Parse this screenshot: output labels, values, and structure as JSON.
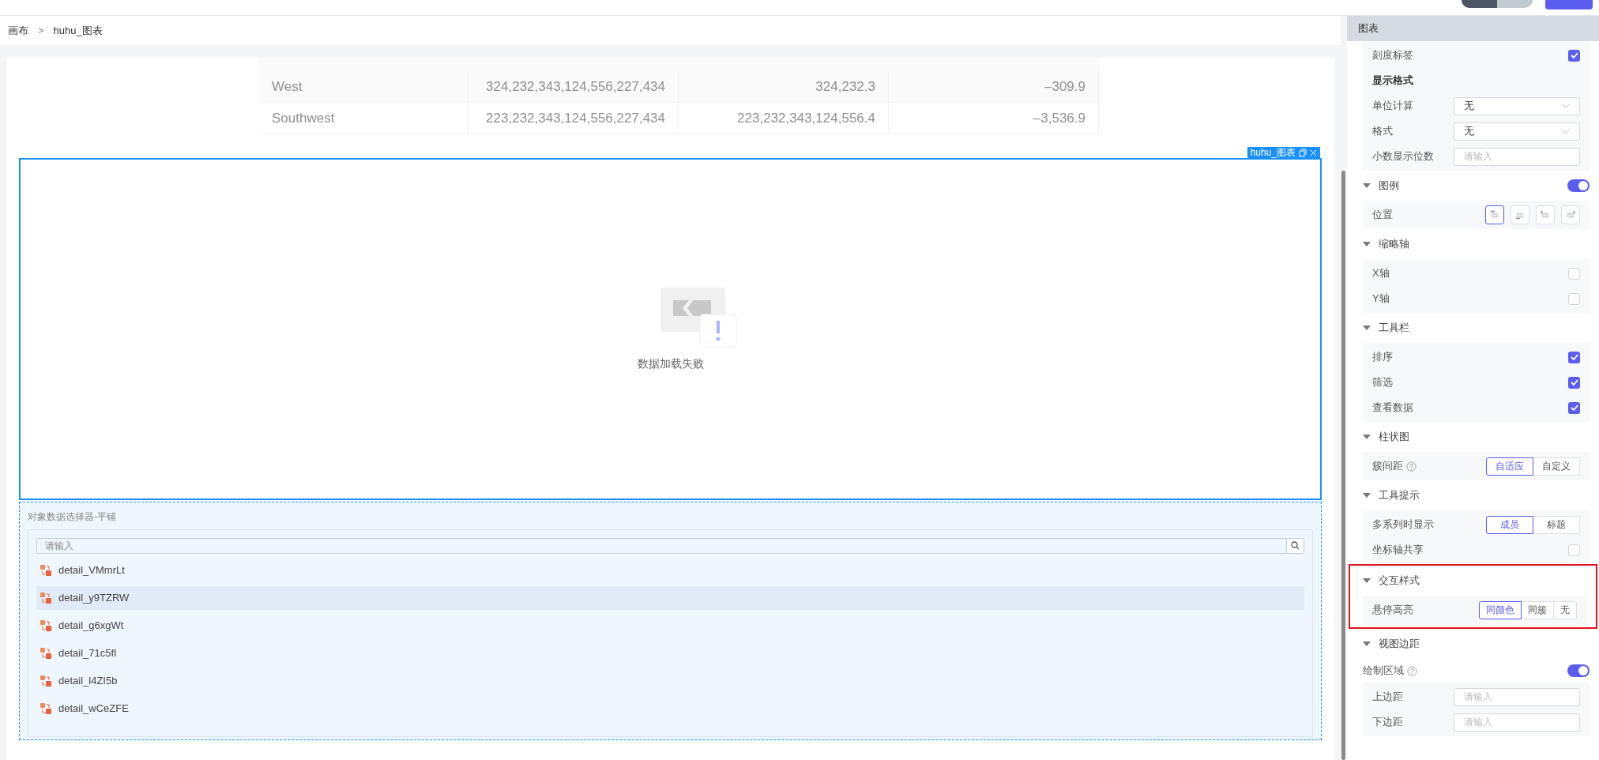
{
  "breadcrumb": {
    "items": [
      "画布",
      "huhu_图表"
    ],
    "separator": ">"
  },
  "table": {
    "rows": [
      {
        "cells": [
          "West",
          "324,232,343,124,556,227,434",
          "324,232.3",
          "–309.9"
        ]
      },
      {
        "cells": [
          "Southwest",
          "223,232,343,124,556,227,434",
          "223,232,343,124,556.4",
          "–3,536.9"
        ]
      }
    ]
  },
  "chart_widget": {
    "tag": "huhu_图表",
    "message": "数据加载失败"
  },
  "selector": {
    "title": "对象数据选择器-平铺",
    "search_placeholder": "请输入",
    "items": [
      {
        "label": "detail_VMmrLt",
        "selected": false
      },
      {
        "label": "detail_y9TZRW",
        "selected": true
      },
      {
        "label": "detail_g6xgWt",
        "selected": false
      },
      {
        "label": "detail_71c5fI",
        "selected": false
      },
      {
        "label": "detail_l4ZI5b",
        "selected": false
      },
      {
        "label": "detail_wCeZFE",
        "selected": false
      }
    ]
  },
  "panel": {
    "title": "图表",
    "blocks": [
      {
        "kind": "group",
        "rows": [
          {
            "kind": "checkbox",
            "label": "刻度标签",
            "checked": true
          },
          {
            "kind": "heading",
            "label": "显示格式"
          },
          {
            "kind": "select",
            "label": "单位计算",
            "value": "无"
          },
          {
            "kind": "select",
            "label": "格式",
            "value": "无"
          },
          {
            "kind": "input",
            "label": "小数显示位数",
            "placeholder": "请输入"
          }
        ]
      },
      {
        "kind": "section",
        "label": "图例",
        "expanded": true,
        "on": true,
        "rows": [
          {
            "kind": "position",
            "label": "位置",
            "options": [
              {
                "selected": true
              },
              {
                "selected": false
              },
              {
                "selected": false
              },
              {
                "selected": false
              }
            ]
          }
        ]
      },
      {
        "kind": "section",
        "label": "缩略轴",
        "expanded": true,
        "rows": [
          {
            "kind": "checkbox",
            "label": "X轴",
            "checked": false
          },
          {
            "kind": "checkbox",
            "label": "Y轴",
            "checked": false
          }
        ]
      },
      {
        "kind": "section",
        "label": "工具栏",
        "expanded": true,
        "rows": [
          {
            "kind": "checkbox",
            "label": "排序",
            "checked": true
          },
          {
            "kind": "checkbox",
            "label": "筛选",
            "checked": true
          },
          {
            "kind": "checkbox",
            "label": "查看数据",
            "checked": true
          }
        ]
      },
      {
        "kind": "section",
        "label": "柱状图",
        "expanded": true,
        "rows": [
          {
            "kind": "segmented",
            "label": "簇间距",
            "help": true,
            "options": [
              {
                "label": "自适应",
                "selected": true
              },
              {
                "label": "自定义",
                "selected": false
              }
            ]
          }
        ]
      },
      {
        "kind": "section",
        "label": "工具提示",
        "expanded": true,
        "rows": [
          {
            "kind": "segmented",
            "label": "多系列时显示",
            "options": [
              {
                "label": "成员",
                "selected": true
              },
              {
                "label": "标题",
                "selected": false
              }
            ]
          },
          {
            "kind": "checkbox",
            "label": "坐标轴共享",
            "checked": false
          }
        ]
      },
      {
        "kind": "section",
        "label": "交互样式",
        "expanded": true,
        "highlighted": true,
        "rows": [
          {
            "kind": "segmented",
            "label": "悬停高亮",
            "options": [
              {
                "label": "同颜色",
                "selected": true
              },
              {
                "label": "同簇",
                "selected": false
              },
              {
                "label": "无",
                "selected": false
              }
            ]
          }
        ]
      },
      {
        "kind": "section",
        "label": "视图边距",
        "expanded": true
      },
      {
        "kind": "switchline",
        "label": "绘制区域",
        "help": true,
        "on": true
      },
      {
        "kind": "group",
        "rows": [
          {
            "kind": "input",
            "label": "上边距",
            "placeholder": "请输入"
          },
          {
            "kind": "input",
            "label": "下边距",
            "placeholder": "请输入"
          }
        ]
      }
    ]
  }
}
